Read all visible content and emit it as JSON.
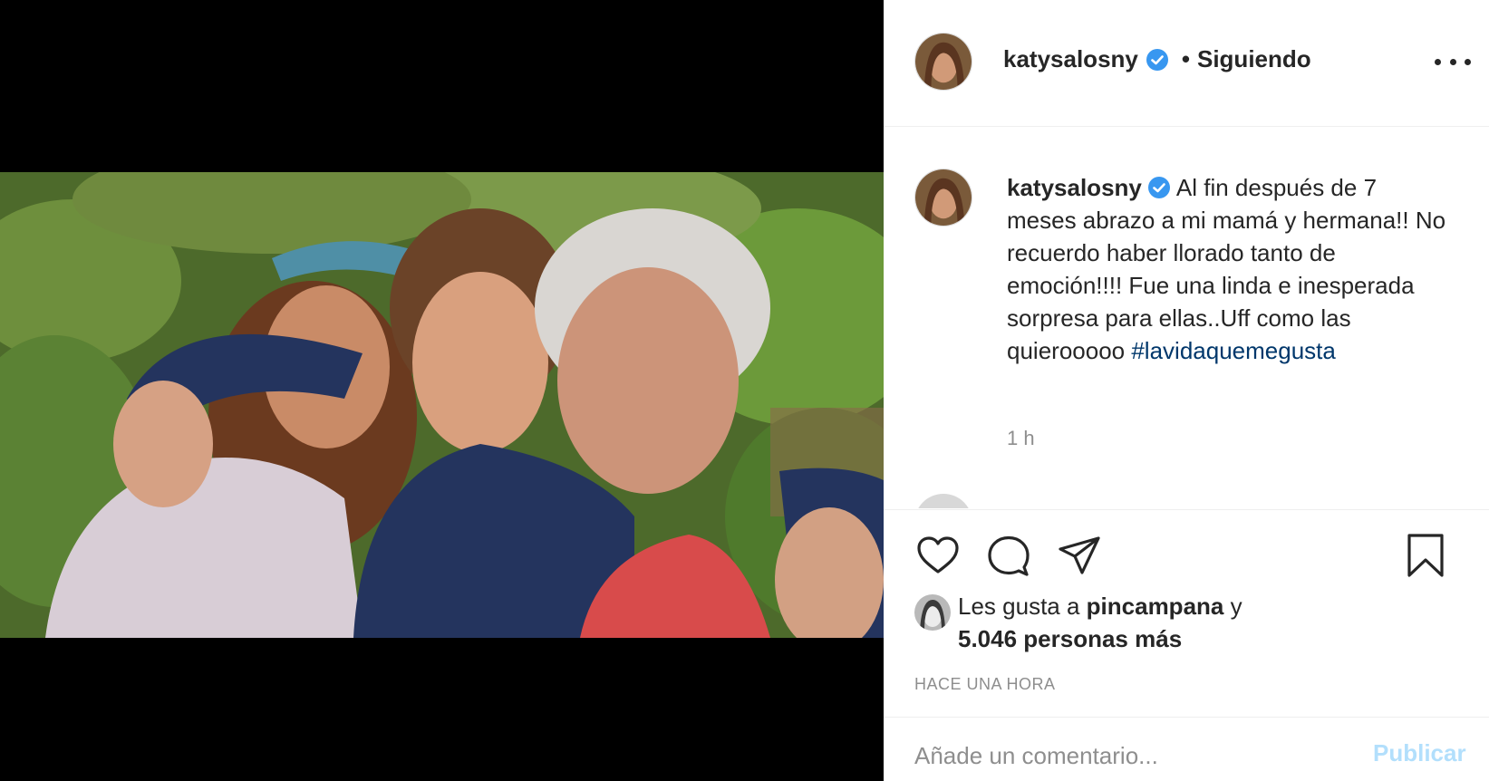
{
  "post": {
    "username": "katysalosny",
    "follow_state": "Siguiendo",
    "separator": "•"
  },
  "caption": {
    "username": "katysalosny",
    "text": "Al fin después de 7 meses abrazo a mi mamá y hermana!! No recuerdo haber llorado tanto de emoción!!!! ",
    "text2": "Fue una linda e inesperada sorpresa para ellas..Uff como las quierooooo ",
    "hashtag": "#lavidaquemegusta",
    "time": "1 h"
  },
  "likes": {
    "prefix": "Les gusta a ",
    "user": "pincampana",
    "connector": " y",
    "others": "5.046 personas más"
  },
  "timestamp": "HACE UNA HORA",
  "comment_box": {
    "placeholder": "Añade un comentario...",
    "publish_label": "Publicar"
  },
  "icons": {
    "verified": "verified-badge-icon",
    "more": "more-options-icon",
    "like": "heart-icon",
    "comment": "speech-bubble-icon",
    "share": "paper-plane-icon",
    "save": "bookmark-icon"
  },
  "colors": {
    "verified": "#3897f0",
    "hashtag": "#00376b",
    "muted": "#8e8e8e",
    "publish_disabled": "#b2dffc"
  }
}
